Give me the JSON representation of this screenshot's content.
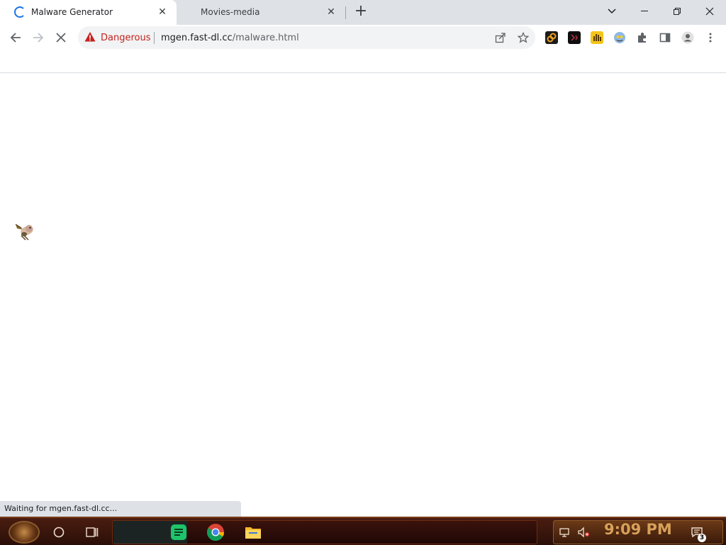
{
  "browser": {
    "tabs": [
      {
        "title": "Malware Generator",
        "loading": true
      },
      {
        "title": "Movies-media",
        "loading": false
      }
    ],
    "new_tab_icon": "plus-icon",
    "close_icon": "close-icon",
    "window_controls": [
      "chevron-down-icon",
      "minimize-icon",
      "restore-icon",
      "close-icon"
    ]
  },
  "toolbar": {
    "back_icon": "arrow-left-icon",
    "forward_icon": "arrow-right-icon",
    "stop_icon": "close-icon",
    "security_label": "Dangerous",
    "url_host": "mgen.fast-dl.cc",
    "url_path": "/malware.html",
    "omnibox_icons": [
      "share-icon",
      "star-icon"
    ],
    "extension_icons": [
      "link-icon",
      "dark-extension-icon",
      "hand-extension-icon",
      "face-extension-icon",
      "puzzle-icon",
      "side-panel-icon",
      "profile-icon",
      "kebab-menu-icon"
    ],
    "accent_color": "#1a73e8",
    "danger_color": "#c5221f"
  },
  "status_bar": {
    "text": "Waiting for mgen.fast-dl.cc..."
  },
  "taskbar": {
    "clock": "9:09 PM",
    "notification_count": "3",
    "apps": [
      "cortana-circle-icon",
      "task-view-icon",
      "notes-app-icon",
      "chrome-icon",
      "file-explorer-icon"
    ],
    "tray_icons": [
      "network-icon",
      "speaker-muted-icon",
      "notification-center-icon"
    ]
  }
}
